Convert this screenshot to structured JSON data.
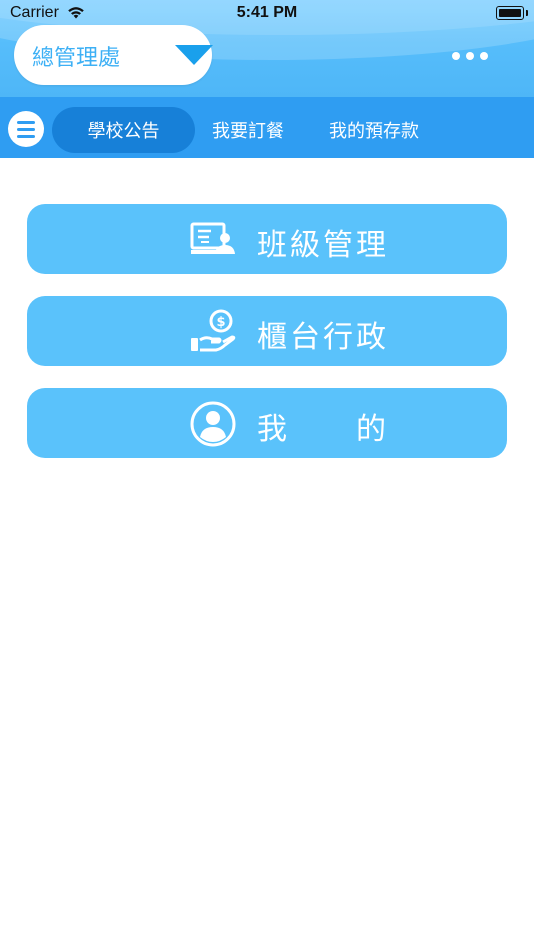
{
  "status_bar": {
    "carrier": "Carrier",
    "time": "5:41 PM"
  },
  "header": {
    "school_selector": "總管理處",
    "more_icon": "more-dots-icon"
  },
  "tabs": [
    {
      "label": "學校公告",
      "active": true
    },
    {
      "label": "我要訂餐",
      "active": false
    },
    {
      "label": "我的預存款",
      "active": false
    }
  ],
  "menu": [
    {
      "label": "班級管理",
      "icon": "classroom-icon"
    },
    {
      "label": "櫃台行政",
      "icon": "hand-coin-icon"
    },
    {
      "label": "我　　的",
      "icon": "user-profile-icon"
    }
  ],
  "colors": {
    "header_top": "#6cc9ff",
    "tabbar": "#2f9df2",
    "active_tab": "#1780d8",
    "card": "#5ac2fb",
    "accent_text": "#3db0f5"
  }
}
